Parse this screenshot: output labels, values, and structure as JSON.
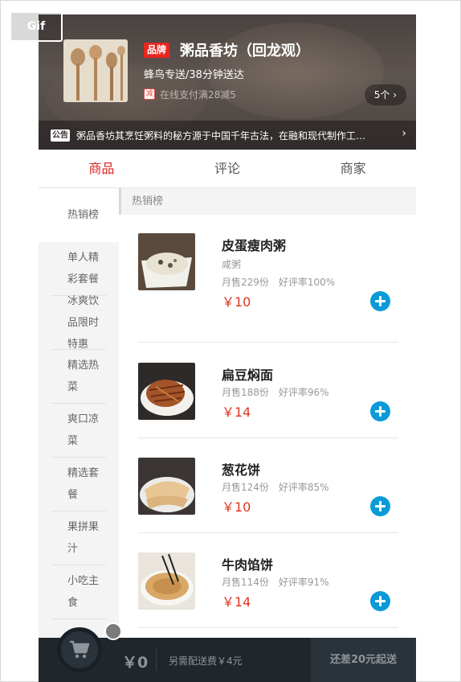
{
  "watermark": {
    "label": "Gif"
  },
  "shop": {
    "brand_label": "品牌",
    "name": "粥品香坊（回龙观）",
    "delivery": "蜂鸟专送/38分钟送达",
    "promo_tag": "减",
    "promo_text": "在线支付满28减5",
    "promo_count": "5个 ›",
    "notice_tag": "公告",
    "notice_text": "粥品香坊其烹饪粥料的秘方源于中国千年古法，在融和现代制作工…",
    "notice_arrow": "›"
  },
  "tabs": [
    {
      "label": "商品",
      "active": true
    },
    {
      "label": "评论",
      "active": false
    },
    {
      "label": "商家",
      "active": false
    }
  ],
  "sidebar": {
    "items": [
      {
        "label": "热销榜"
      },
      {
        "label": "单人精彩套餐"
      },
      {
        "label": "冰爽饮品限时特惠"
      },
      {
        "label": "精选热菜"
      },
      {
        "label": "爽口凉菜"
      },
      {
        "label": "精选套餐"
      },
      {
        "label": "果拼果汁"
      },
      {
        "label": "小吃主食"
      }
    ]
  },
  "category": {
    "title": "热销榜"
  },
  "foods": [
    {
      "name": "皮蛋瘦肉粥",
      "desc": "咸粥",
      "sales": "月售229份",
      "rating": "好评率100%",
      "price": "￥10"
    },
    {
      "name": "扁豆焖面",
      "desc": "",
      "sales": "月售188份",
      "rating": "好评率96%",
      "price": "￥14"
    },
    {
      "name": "葱花饼",
      "desc": "",
      "sales": "月售124份",
      "rating": "好评率85%",
      "price": "￥10"
    },
    {
      "name": "牛肉馅饼",
      "desc": "",
      "sales": "月售114份",
      "rating": "好评率91%",
      "price": "￥14"
    }
  ],
  "cart": {
    "price": "￥0",
    "delivery_fee": "另需配送费￥4元",
    "checkout": "还差20元起送"
  }
}
